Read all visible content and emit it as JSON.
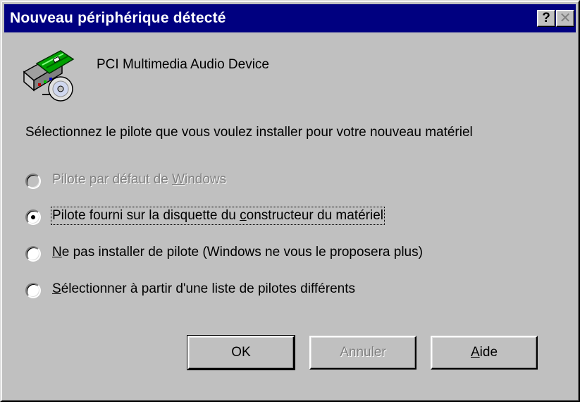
{
  "window": {
    "title": "Nouveau périphérique détecté",
    "help_glyph": "?",
    "close_glyph": "✕"
  },
  "device": {
    "icon": "sound-card-cd-icon",
    "name": "PCI Multimedia Audio Device"
  },
  "prompt": "Sélectionnez le pilote que vous voulez installer pour votre nouveau matériel",
  "options": [
    {
      "pre": "Pilote par défaut de ",
      "key": "W",
      "post": "indows",
      "selected": false,
      "enabled": false
    },
    {
      "pre": "Pilote fourni sur la disquette du ",
      "key": "c",
      "post": "onstructeur du matériel",
      "selected": true,
      "enabled": true
    },
    {
      "pre": "",
      "key": "N",
      "post": "e pas installer de pilote (Windows ne vous le proposera plus)",
      "selected": false,
      "enabled": true
    },
    {
      "pre": "",
      "key": "S",
      "post": "électionner à partir d'une liste de pilotes différents",
      "selected": false,
      "enabled": true
    }
  ],
  "buttons": {
    "ok": "OK",
    "cancel": "Annuler",
    "help_pre": "",
    "help_key": "A",
    "help_post": "ide"
  },
  "colors": {
    "titlebar": "#000080",
    "face": "#c0c0c0",
    "disabled_text": "#808080"
  }
}
